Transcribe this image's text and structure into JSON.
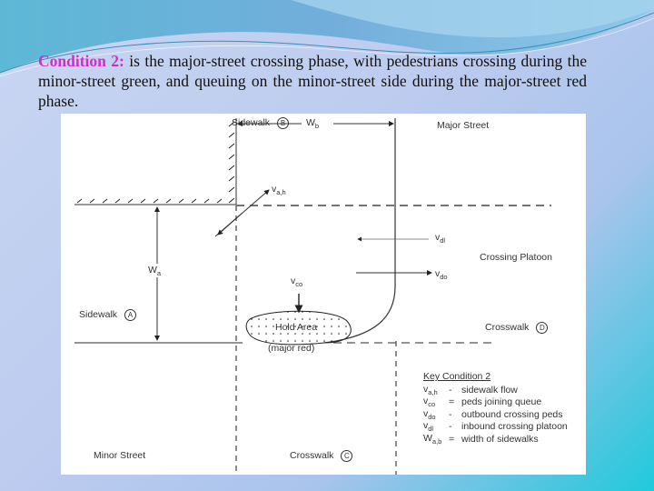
{
  "caption": {
    "highlight": "Condition 2:",
    "text": " is the major-street crossing phase, with pedestrians crossing during the minor-street green, and queuing on the minor-street side during the major-street red phase."
  },
  "colors": {
    "highlight": "#d42bd0",
    "background_accent": "#1fcadb"
  },
  "diagram": {
    "sidewalk_b": "Sidewalk",
    "marker_b": "B",
    "major_street": "Major Street",
    "wb": "W",
    "wb_sub": "b",
    "vah": "v",
    "vah_sub": "a,h",
    "vdi": "v",
    "vdi_sub": "dl",
    "crossing_platoon": "Crossing Platoon",
    "vdo": "v",
    "vdo_sub": "do",
    "wa": "W",
    "wa_sub": "a",
    "vco": "v",
    "vco_sub": "co",
    "sidewalk_a": "Sidewalk",
    "marker_a": "A",
    "hold_area": "Hold Area",
    "major_red": "(major red)",
    "crosswalk_d": "Crosswalk",
    "marker_d": "D",
    "minor_street": "Minor Street",
    "crosswalk_c": "Crosswalk",
    "marker_c": "C"
  },
  "key": {
    "title": "Key Condition 2",
    "rows": [
      {
        "sym": "v",
        "sub": "a,h",
        "eq": "-",
        "desc": "sidewalk flow"
      },
      {
        "sym": "v",
        "sub": "co",
        "eq": "=",
        "desc": "peds joining queue"
      },
      {
        "sym": "v",
        "sub": "do",
        "eq": "-",
        "desc": "outbound crossing peds"
      },
      {
        "sym": "v",
        "sub": "dl",
        "eq": "-",
        "desc": "inbound crossing platoon"
      },
      {
        "sym": "W",
        "sub": "a,b",
        "eq": "=",
        "desc": "width of sidewalks"
      }
    ]
  }
}
